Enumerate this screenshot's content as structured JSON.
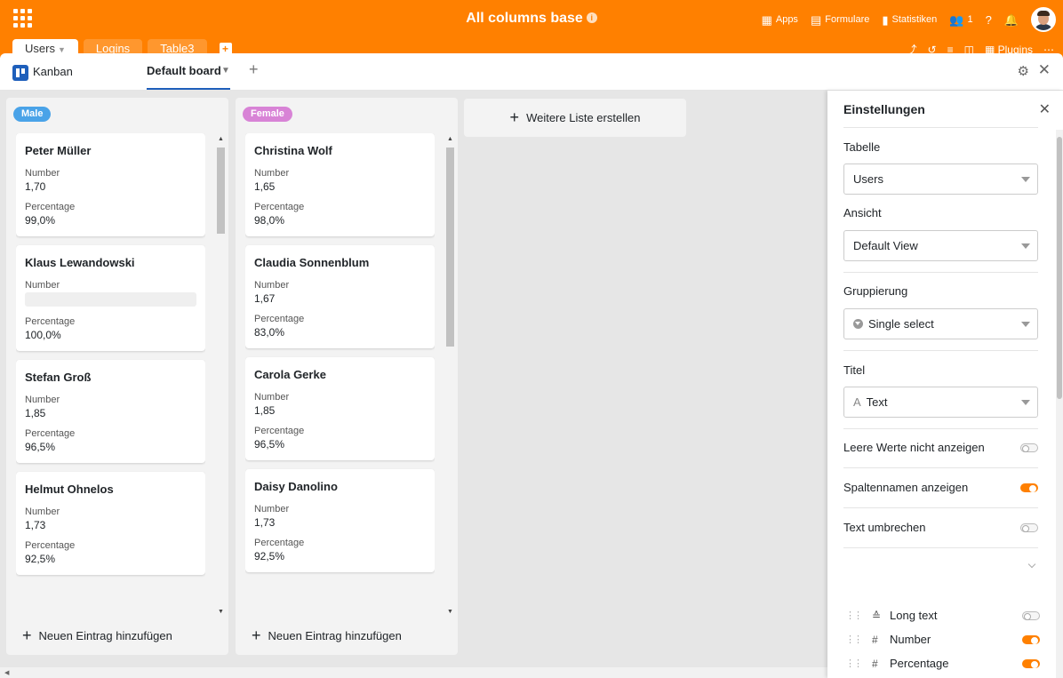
{
  "app": {
    "base_title": "All columns base",
    "nav": [
      {
        "icon": "apps-icon",
        "label": "Apps"
      },
      {
        "icon": "form-icon",
        "label": "Formulare"
      },
      {
        "icon": "stats-icon",
        "label": "Statistiken"
      },
      {
        "icon": "users-icon",
        "label": "1"
      }
    ],
    "tabs": [
      "Users",
      "Logins",
      "Table3"
    ],
    "plugins_label": "Plugins",
    "accent_color": "#ff8000"
  },
  "plugin": {
    "name": "Kanban",
    "board": "Default board"
  },
  "lists": [
    {
      "badge": "Male",
      "badge_color": "#4aa3e8",
      "add_entry": "Neuen Eintrag hinzufügen",
      "cards": [
        {
          "title": "Peter Müller",
          "number_label": "Number",
          "number": "1,70",
          "pct_label": "Percentage",
          "pct": "99,0%"
        },
        {
          "title": "Klaus Lewandowski",
          "number_label": "Number",
          "number": "",
          "pct_label": "Percentage",
          "pct": "100,0%"
        },
        {
          "title": "Stefan Groß",
          "number_label": "Number",
          "number": "1,85",
          "pct_label": "Percentage",
          "pct": "96,5%"
        },
        {
          "title": "Helmut Ohnelos",
          "number_label": "Number",
          "number": "1,73",
          "pct_label": "Percentage",
          "pct": "92,5%"
        }
      ]
    },
    {
      "badge": "Female",
      "badge_color": "#d883d6",
      "add_entry": "Neuen Eintrag hinzufügen",
      "cards": [
        {
          "title": "Christina Wolf",
          "number_label": "Number",
          "number": "1,65",
          "pct_label": "Percentage",
          "pct": "98,0%"
        },
        {
          "title": "Claudia Sonnenblum",
          "number_label": "Number",
          "number": "1,67",
          "pct_label": "Percentage",
          "pct": "83,0%"
        },
        {
          "title": "Carola Gerke",
          "number_label": "Number",
          "number": "1,85",
          "pct_label": "Percentage",
          "pct": "96,5%"
        },
        {
          "title": "Daisy Danolino",
          "number_label": "Number",
          "number": "1,73",
          "pct_label": "Percentage",
          "pct": "92,5%"
        }
      ]
    }
  ],
  "new_list_label": "Weitere Liste erstellen",
  "settings": {
    "title": "Einstellungen",
    "table_label": "Tabelle",
    "table_value": "Users",
    "view_label": "Ansicht",
    "view_value": "Default View",
    "group_label": "Gruppierung",
    "group_value": "Single select",
    "title_label": "Titel",
    "title_value": "Text",
    "toggles": [
      {
        "label": "Leere Werte nicht anzeigen",
        "on": false
      },
      {
        "label": "Spaltennamen anzeigen",
        "on": true
      },
      {
        "label": "Text umbrechen",
        "on": false
      }
    ],
    "columns": [
      {
        "icon": "long-text-icon",
        "name": "Long text",
        "on": false
      },
      {
        "icon": "number-icon",
        "name": "Number",
        "on": true
      },
      {
        "icon": "number-icon",
        "name": "Percentage",
        "on": true
      }
    ]
  }
}
